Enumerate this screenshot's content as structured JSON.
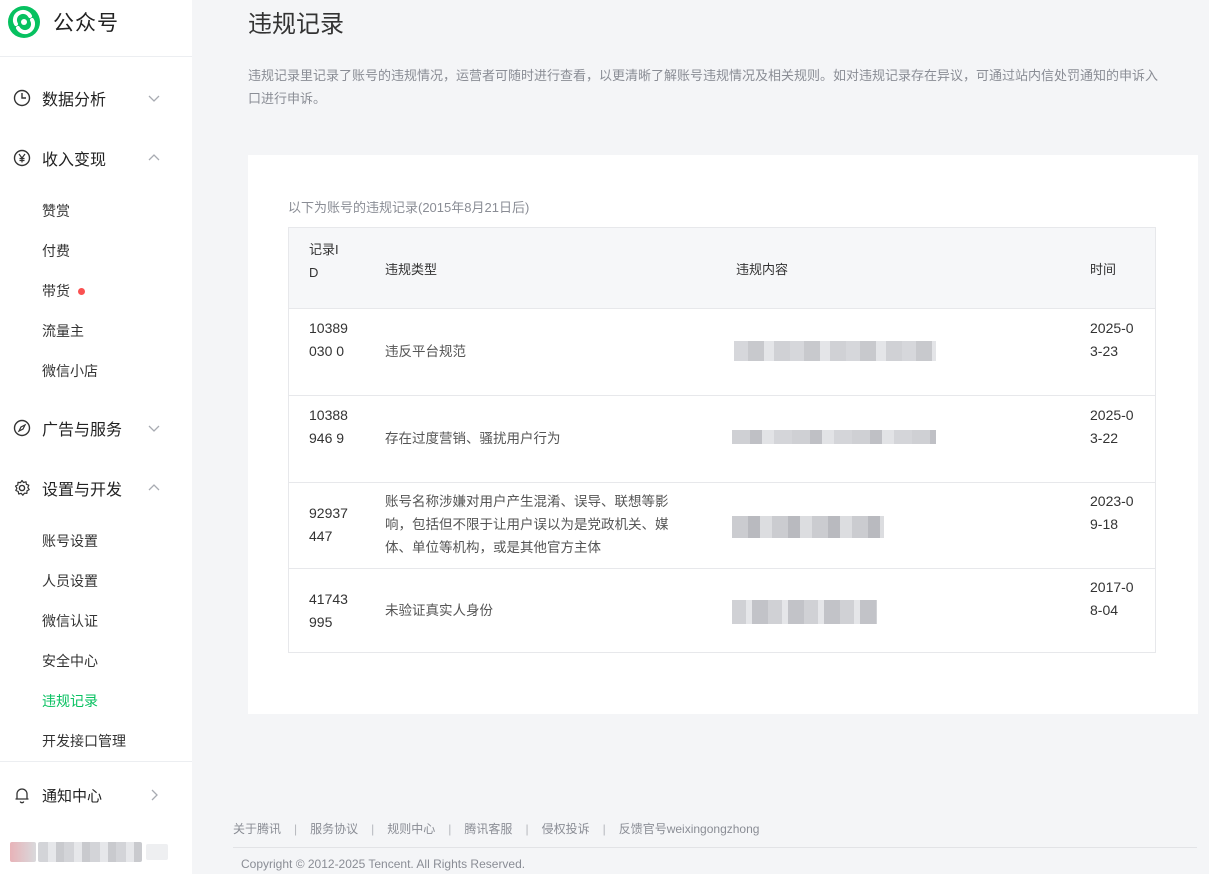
{
  "brand": {
    "name": "公众号",
    "color": "#07c160"
  },
  "sidebar": {
    "sections": [
      {
        "label": "数据分析",
        "icon": "clock-icon",
        "expanded": false
      },
      {
        "label": "收入变现",
        "icon": "yen-icon",
        "expanded": true,
        "items": [
          {
            "label": "赞赏"
          },
          {
            "label": "付费"
          },
          {
            "label": "带货",
            "badge": "red-dot"
          },
          {
            "label": "流量主"
          },
          {
            "label": "微信小店"
          }
        ]
      },
      {
        "label": "广告与服务",
        "icon": "compass-icon",
        "expanded": false
      },
      {
        "label": "设置与开发",
        "icon": "gear-icon",
        "expanded": true,
        "items": [
          {
            "label": "账号设置"
          },
          {
            "label": "人员设置"
          },
          {
            "label": "微信认证"
          },
          {
            "label": "安全中心"
          },
          {
            "label": "违规记录",
            "active": true
          },
          {
            "label": "开发接口管理"
          }
        ]
      },
      {
        "label": "通知中心",
        "icon": "bell-icon",
        "expanded": false
      }
    ]
  },
  "page": {
    "title": "违规记录",
    "description": "违规记录里记录了账号的违规情况，运营者可随时进行查看，以更清晰了解账号违规情况及相关规则。如对违规记录存在异议，可通过站内信处罚通知的申诉入口进行申诉。"
  },
  "records": {
    "subtitle": "以下为账号的违规记录(2015年8月21日后)",
    "headers": {
      "id": "记录ID",
      "type": "违规类型",
      "content": "违规内容",
      "time": "时间"
    },
    "rows": [
      {
        "id": "10389030 0",
        "type": "违反平台规范",
        "content": "[blurred]",
        "time": "2025-03-23"
      },
      {
        "id": "10388946 9",
        "type": "存在过度营销、骚扰用户行为",
        "content": "[blurred]",
        "time": "2025-03-22"
      },
      {
        "id": "92937447",
        "type": "账号名称涉嫌对用户产生混淆、误导、联想等影响，包括但不限于让用户误以为是党政机关、媒体、单位等机构，或是其他官方主体",
        "content": "[blurred]",
        "time": "2023-09-18"
      },
      {
        "id": "41743995",
        "type": "未验证真实人身份",
        "content": "[blurred]",
        "time": "2017-08-04"
      }
    ]
  },
  "footer": {
    "links": [
      "关于腾讯",
      "服务协议",
      "规则中心",
      "腾讯客服",
      "侵权投诉",
      "反馈官号weixingongzhong"
    ],
    "separator": "|",
    "copyright": "Copyright © 2012-2025 Tencent. All Rights Reserved."
  }
}
